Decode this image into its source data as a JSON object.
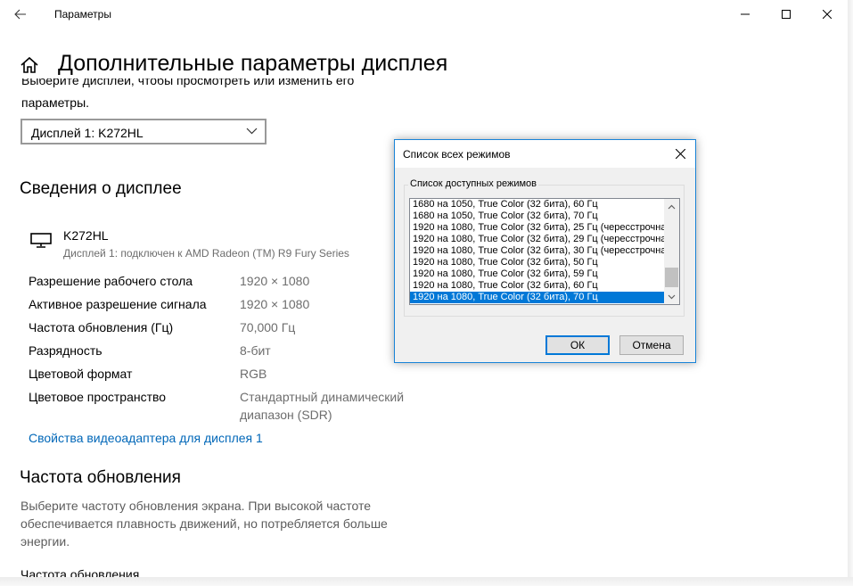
{
  "app": {
    "title": "Параметры",
    "page_title": "Дополнительные параметры дисплея"
  },
  "display_select": {
    "prompt_line1": "Выберите дисплей, чтобы просмотреть или изменить его",
    "prompt_line2": "параметры.",
    "value": "Дисплей 1: K272HL"
  },
  "display_info": {
    "heading": "Сведения о дисплее",
    "monitor_name": "K272HL",
    "monitor_desc": "Дисплей 1: подключен к AMD Radeon (TM) R9 Fury Series",
    "properties": [
      {
        "label": "Разрешение рабочего стола",
        "value": "1920 × 1080"
      },
      {
        "label": "Активное разрешение сигнала",
        "value": "1920 × 1080"
      },
      {
        "label": "Частота обновления (Гц)",
        "value": "70,000 Гц"
      },
      {
        "label": "Разрядность",
        "value": "8-бит"
      },
      {
        "label": "Цветовой формат",
        "value": "RGB"
      },
      {
        "label": "Цветовое пространство",
        "value": "Стандартный динамический",
        "value2": "диапазон (SDR)"
      }
    ],
    "adapter_link": "Свойства видеоадаптера для дисплея 1"
  },
  "refresh": {
    "heading": "Частота обновления",
    "description": "Выберите частоту обновления экрана. При высокой частоте обеспечивается плавность движений, но потребляется больше энергии.",
    "cut_label": "Частота обновления"
  },
  "dialog": {
    "title": "Список всех режимов",
    "group_label": "Список доступных режимов",
    "modes": [
      "1680 на 1050, True Color (32 бита), 60 Гц",
      "1680 на 1050, True Color (32 бита), 70 Гц",
      "1920 на 1080, True Color (32 бита), 25 Гц (чересстрочна",
      "1920 на 1080, True Color (32 бита), 29 Гц (чересстрочна",
      "1920 на 1080, True Color (32 бита), 30 Гц (чересстрочна",
      "1920 на 1080, True Color (32 бита), 50 Гц",
      "1920 на 1080, True Color (32 бита), 59 Гц",
      "1920 на 1080, True Color (32 бита), 60 Гц",
      "1920 на 1080, True Color (32 бита), 70 Гц"
    ],
    "selected_index": 8,
    "ok_label": "ОК",
    "cancel_label": "Отмена"
  },
  "colors": {
    "accent": "#0078d7",
    "link": "#0067b8",
    "secondary_text": "#6d6d6d"
  }
}
